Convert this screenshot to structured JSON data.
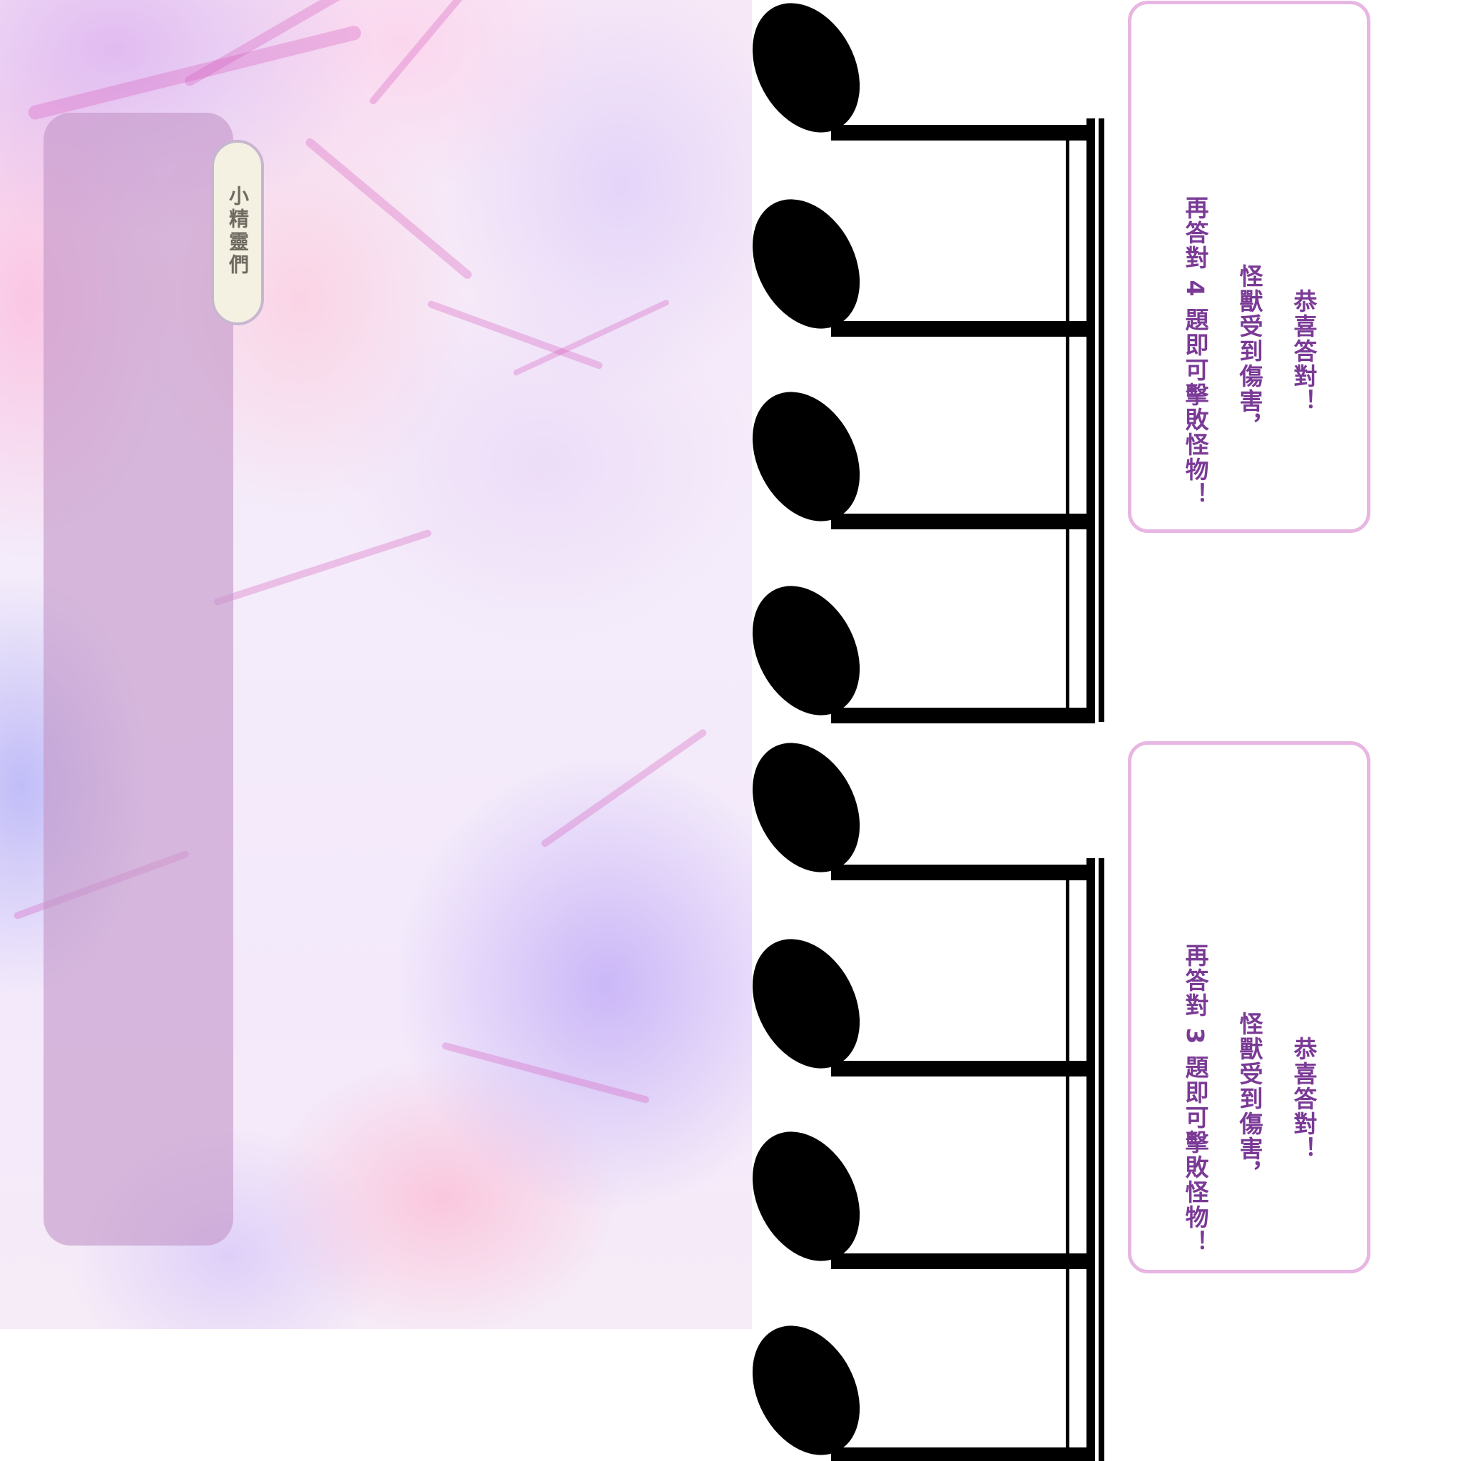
{
  "scene": {
    "fairy_tab_label": "小精靈們"
  },
  "messages": [
    {
      "line1": "恭喜答對！",
      "line2": "怪獸受到傷害，",
      "line3": "再答對 4 題即可擊敗怪物！"
    },
    {
      "line1": "恭喜答對！",
      "line2": "怪獸受到傷害，",
      "line3": "再答對 3 題即可擊敗怪物！"
    }
  ],
  "colors": {
    "message_text": "#7a3a96",
    "message_border": "#e7b6e2",
    "panel": "#c496c8",
    "note": "#000000"
  },
  "note_groups": [
    {
      "icon": "sixteenth-notes-icon",
      "count": 4
    },
    {
      "icon": "sixteenth-notes-icon",
      "count": 4
    }
  ]
}
